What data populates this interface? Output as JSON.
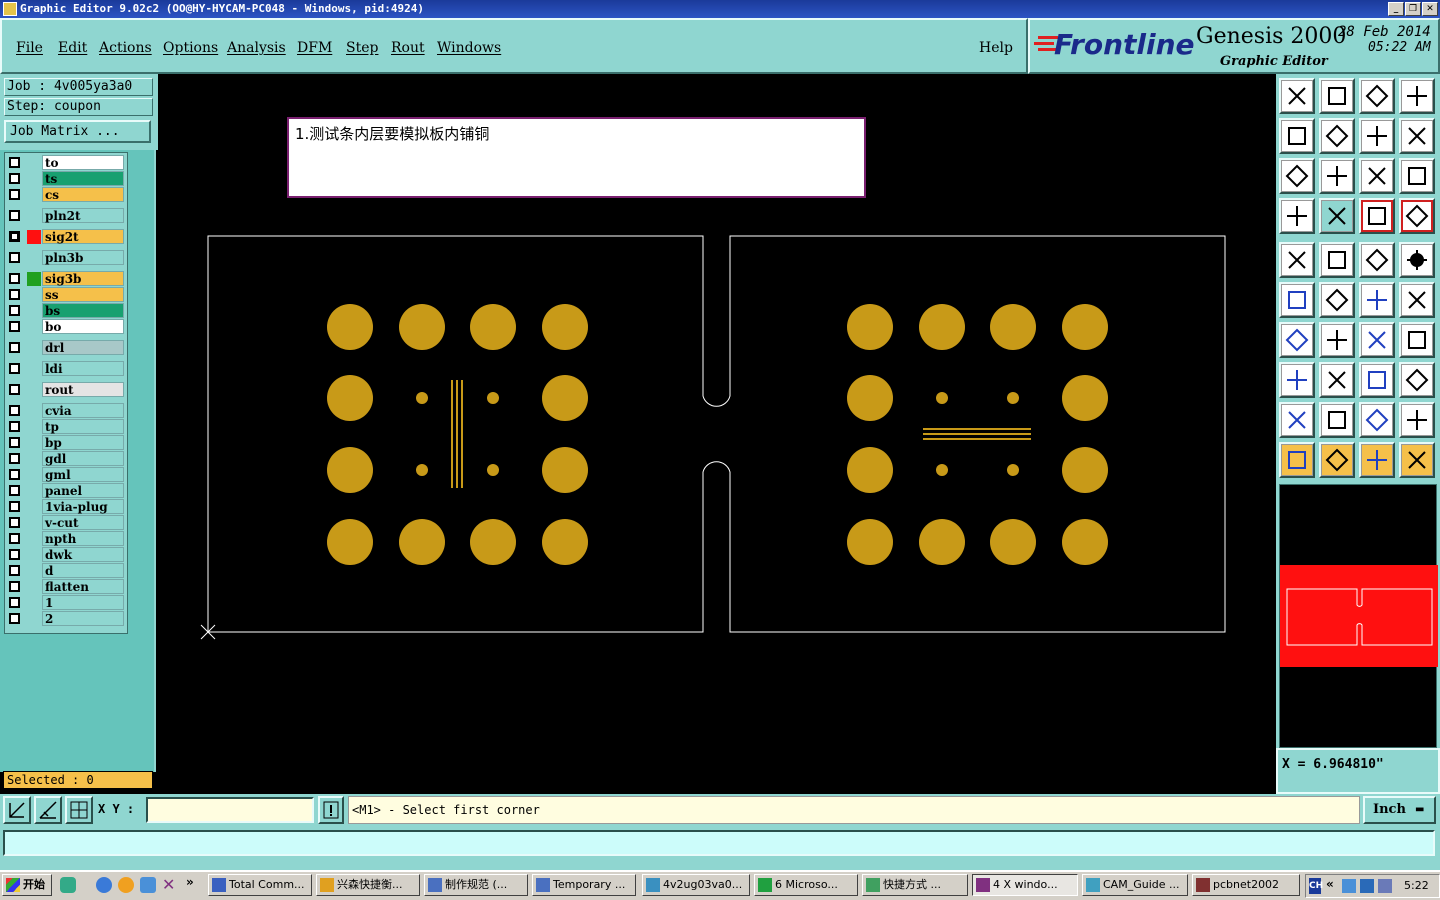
{
  "window": {
    "title": "Graphic Editor 9.02c2  (OO@HY-HYCAM-PC048 - Windows, pid:4924)"
  },
  "menu": [
    "File",
    "Edit",
    "Actions",
    "Options",
    "Analysis",
    "DFM",
    "Step",
    "Rout",
    "Windows"
  ],
  "help_label": "Help",
  "logo": {
    "brand": "Frontline",
    "product": "Genesis 2000",
    "subtitle": "Graphic Editor",
    "date": "28 Feb 2014",
    "time": "05:22  AM"
  },
  "job": {
    "job_label": "Job  :  4v005ya3a0",
    "step_label": "Step:  coupon",
    "matrix_button": "Job Matrix ..."
  },
  "layers": [
    {
      "name": "to",
      "color": "#ffffff",
      "checked": false,
      "swatch": ""
    },
    {
      "name": "ts",
      "color": "#18a070",
      "checked": false,
      "swatch": ""
    },
    {
      "name": "cs",
      "color": "#f5c04a",
      "checked": false,
      "swatch": ""
    },
    {
      "name": "pln2t",
      "color": "#8fd6d0",
      "checked": false,
      "swatch": ""
    },
    {
      "name": "sig2t",
      "color": "#f5c04a",
      "checked": true,
      "swatch": "#ff1010"
    },
    {
      "name": "pln3b",
      "color": "#8fd6d0",
      "checked": false,
      "swatch": ""
    },
    {
      "name": "sig3b",
      "color": "#f5c04a",
      "checked": false,
      "swatch": "#20a020"
    },
    {
      "name": "ss",
      "color": "#f5c04a",
      "checked": false,
      "swatch": ""
    },
    {
      "name": "bs",
      "color": "#18a070",
      "checked": false,
      "swatch": ""
    },
    {
      "name": "bo",
      "color": "#ffffff",
      "checked": false,
      "swatch": ""
    },
    {
      "name": "drl",
      "color": "#a8c8c8",
      "checked": false,
      "swatch": ""
    },
    {
      "name": "ldi",
      "color": "#8fd6d0",
      "checked": false,
      "swatch": ""
    },
    {
      "name": "rout",
      "color": "#e4e4e4",
      "checked": false,
      "swatch": ""
    },
    {
      "name": "cvia",
      "color": "#8fd6d0",
      "checked": false,
      "swatch": ""
    },
    {
      "name": "tp",
      "color": "#8fd6d0",
      "checked": false,
      "swatch": ""
    },
    {
      "name": "bp",
      "color": "#8fd6d0",
      "checked": false,
      "swatch": ""
    },
    {
      "name": "gdl",
      "color": "#8fd6d0",
      "checked": false,
      "swatch": ""
    },
    {
      "name": "gml",
      "color": "#8fd6d0",
      "checked": false,
      "swatch": ""
    },
    {
      "name": "panel",
      "color": "#8fd6d0",
      "checked": false,
      "swatch": ""
    },
    {
      "name": "1via-plug",
      "color": "#8fd6d0",
      "checked": false,
      "swatch": ""
    },
    {
      "name": "v-cut",
      "color": "#8fd6d0",
      "checked": false,
      "swatch": ""
    },
    {
      "name": "npth",
      "color": "#8fd6d0",
      "checked": false,
      "swatch": ""
    },
    {
      "name": "dwk",
      "color": "#8fd6d0",
      "checked": false,
      "swatch": ""
    },
    {
      "name": "d",
      "color": "#8fd6d0",
      "checked": false,
      "swatch": ""
    },
    {
      "name": "flatten",
      "color": "#8fd6d0",
      "checked": false,
      "swatch": ""
    },
    {
      "name": "1",
      "color": "#8fd6d0",
      "checked": false,
      "swatch": ""
    },
    {
      "name": "2",
      "color": "#8fd6d0",
      "checked": false,
      "swatch": ""
    }
  ],
  "selected_label": "Selected : 0",
  "note_text": "1.测试条内层要模拟板内铺铜",
  "coord_readout": "X  =  6.964810\"",
  "command": {
    "xy_label": "X Y :",
    "xy_value": "",
    "prompt": "<M1> - Select first corner",
    "units": "Inch"
  },
  "taskbar": {
    "start": "开始",
    "tasks": [
      "Total Comm...",
      "兴森快捷衡...",
      "制作规范 (...",
      "Temporary ...",
      "4v2ug03va0...",
      "6 Microso...",
      "快捷方式 ...",
      "4 X windo...",
      "CAM_Guide ...",
      "pcbnet2002"
    ],
    "clock": "5:22",
    "lang": "CH"
  },
  "colors": {
    "teal": "#8fd6d0",
    "copper": "#c89a18",
    "highlight_red": "#ff1010"
  }
}
